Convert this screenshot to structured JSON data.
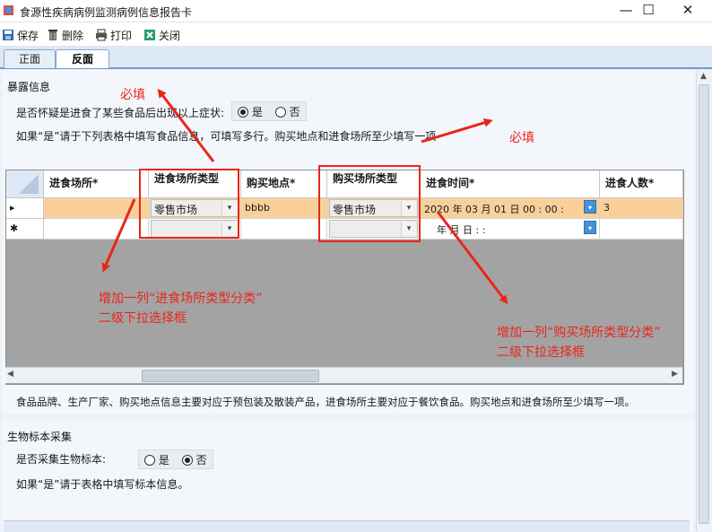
{
  "window": {
    "title": "食源性疾病病例监测病例信息报告卡",
    "minimize_glyph": "—",
    "maximize_glyph": "☐",
    "close_glyph": "✕"
  },
  "toolbar": {
    "save": "保存",
    "delete": "删除",
    "print": "打印",
    "close": "关闭"
  },
  "tabs": {
    "front": "正面",
    "back": "反面"
  },
  "exposure": {
    "section_title": "暴露信息",
    "question": "是否怀疑是进食了某些食品后出现以上症状:",
    "yes": "是",
    "no": "否",
    "selected": "是",
    "instruction": "如果“是”请于下列表格中填写食品信息，可填写多行。购买地点和进食场所至少填写一项"
  },
  "grid": {
    "columns": {
      "venue": "进食场所*",
      "venue_type": "进食场所类型",
      "purchase_place": "购买地点*",
      "purchase_type": "购买场所类型",
      "meal_time": "进食时间*",
      "people": "进食人数*"
    },
    "row_markers": {
      "current": "▸",
      "new": "✱"
    },
    "rows": [
      {
        "venue": "",
        "venue_type": "零售市场",
        "purchase_place": "bbbb",
        "purchase_type": "零售市场",
        "meal_time": "2020 年 03 月 01 日  00 : 00 :",
        "people": "3"
      },
      {
        "venue": "",
        "venue_type": "",
        "purchase_place": "",
        "purchase_type": "",
        "meal_time": "年    月    日      :    :",
        "people": ""
      }
    ]
  },
  "note": "食品品牌、生产厂家、购买地点信息主要对应于预包装及散装产品，进食场所主要对应于餐饮食品。购买地点和进食场所至少填写一项。",
  "bio": {
    "section_title": "生物标本采集",
    "question": "是否采集生物标本:",
    "yes": "是",
    "no": "否",
    "selected": "否",
    "instruction": "如果“是”请于表格中填写标本信息。"
  },
  "annotations": {
    "required_1": "必填",
    "required_2": "必填",
    "add_venue_line1": "增加一列“进食场所类型分类”",
    "add_venue_line2": "二级下拉选择框",
    "add_purchase_line1": "增加一列“购买场所类型分类”",
    "add_purchase_line2": "二级下拉选择框"
  },
  "colors": {
    "annotation_red": "#e8261c",
    "selected_row": "#f9d09a",
    "accent_blue": "#4b8fd6"
  }
}
